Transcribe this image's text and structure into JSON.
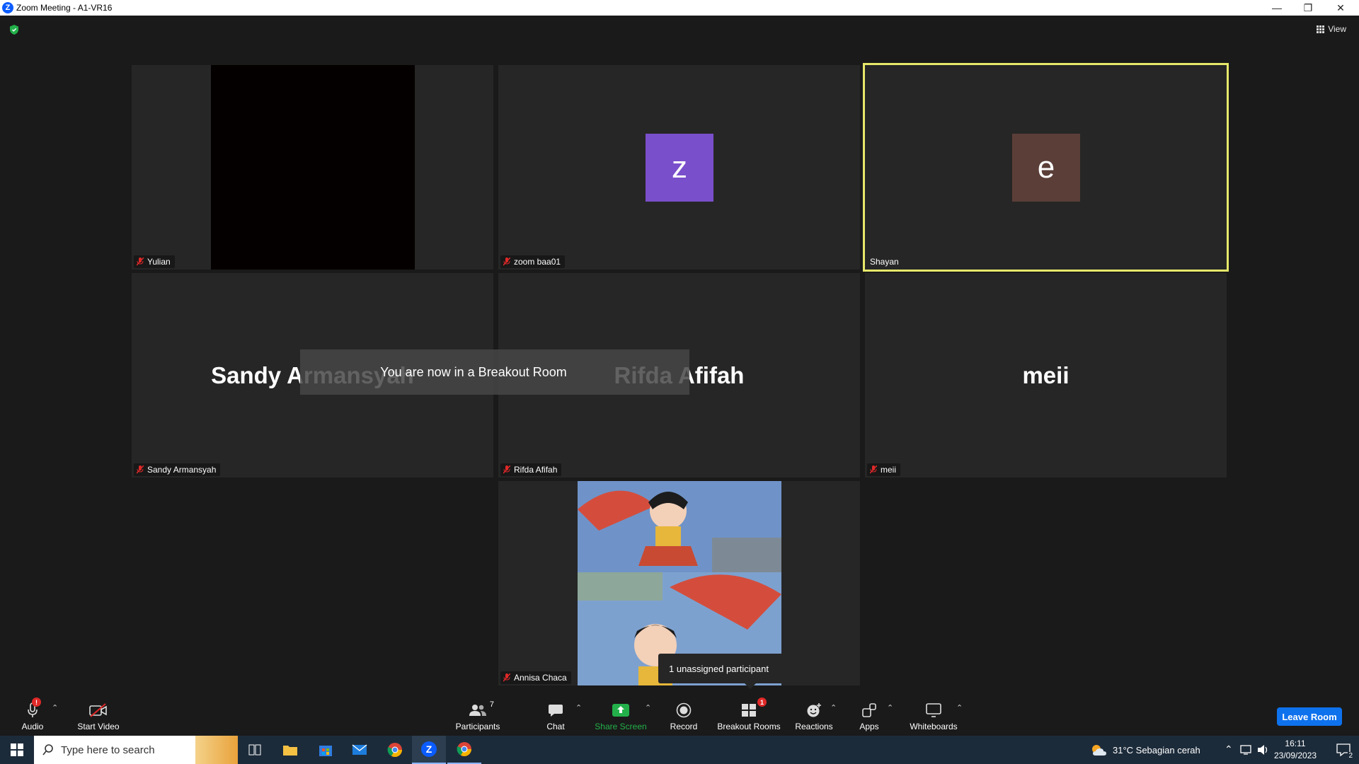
{
  "window": {
    "title": "Zoom Meeting - A1-VR16"
  },
  "view_button": {
    "label": "View"
  },
  "tiles": [
    {
      "name": "Yulian",
      "muted": true
    },
    {
      "name": "zoom baa01",
      "muted": true,
      "avatar_letter": "z",
      "avatar_color": "#7a4fcb"
    },
    {
      "name": "Shayan",
      "muted": false,
      "avatar_letter": "e",
      "avatar_color": "#5b3e38",
      "active_speaker": true
    },
    {
      "name": "Sandy Armansyah",
      "muted": true,
      "display_name": "Sandy Armansyah"
    },
    {
      "name": "Rifda Afifah",
      "muted": true,
      "display_name": "Rifda Afifah"
    },
    {
      "name": "meii",
      "muted": true,
      "display_name": "meii"
    },
    {
      "name": "Annisa Chaca",
      "muted": true
    }
  ],
  "notification": {
    "text": "You are now in a Breakout Room"
  },
  "tooltip": {
    "text": "1 unassigned participant"
  },
  "toolbar": {
    "audio": "Audio",
    "start_video": "Start Video",
    "participants": "Participants",
    "participants_count": "7",
    "chat": "Chat",
    "share_screen": "Share Screen",
    "record": "Record",
    "breakout_rooms": "Breakout Rooms",
    "breakout_badge": "1",
    "reactions": "Reactions",
    "apps": "Apps",
    "whiteboards": "Whiteboards",
    "leave": "Leave Room"
  },
  "taskbar": {
    "search_placeholder": "Type here to search",
    "weather": "31°C  Sebagian cerah",
    "time": "16:11",
    "date": "23/09/2023",
    "notifications": "2"
  },
  "colors": {
    "accent": "#0e72ed",
    "speaker_border": "#e6e86a",
    "share_green": "#23b04a"
  }
}
